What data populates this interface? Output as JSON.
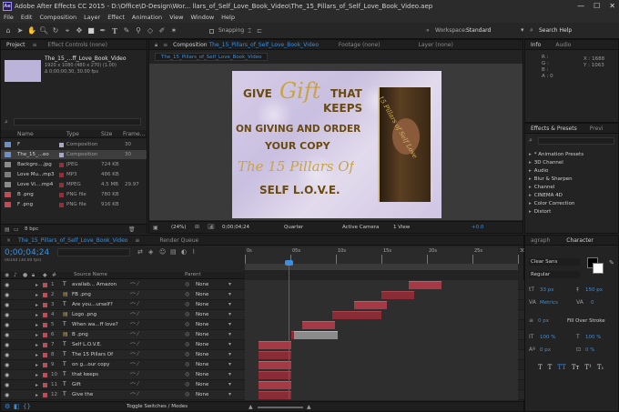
{
  "window": {
    "title": "Adobe After Effects CC 2015 - D:\\Office\\D-Design\\Wor... llars_of_Self_Love_Book_Video\\The_15_Pillars_of_Self_Love_Book_Video.aep",
    "minimize": "—",
    "maximize": "☐",
    "close": "✕"
  },
  "menu": [
    "File",
    "Edit",
    "Composition",
    "Layer",
    "Effect",
    "Animation",
    "View",
    "Window",
    "Help"
  ],
  "toolbar": {
    "snapping": "Snapping",
    "workspace_label": "Workspace:",
    "workspace_value": "Standard",
    "search_help": "Search Help"
  },
  "project": {
    "tab_project": "Project",
    "tab_effect_controls": "Effect Controls (none)",
    "comp_name": "The_15_...ff_Love_Book_Video",
    "comp_info1": "1920 x 1080  (480 x 270) (1.00)",
    "comp_info2": "Δ 0;00;00;30, 30.00 fps",
    "search_placeholder": "",
    "col_name": "Name",
    "col_type": "Type",
    "col_size": "Size",
    "col_frame": "Frame...",
    "items": [
      {
        "name": "F",
        "type": "Composition",
        "size": "",
        "frame": "30",
        "color": "#6f8fc7"
      },
      {
        "name": "The_15_...eo",
        "type": "Composition",
        "size": "",
        "frame": "30",
        "color": "#6f8fc7"
      },
      {
        "name": "Backgro....jpg",
        "type": "JPEG",
        "size": "724 KB",
        "frame": "",
        "color": "#8b8b8b"
      },
      {
        "name": "Love Mu...mp3",
        "type": "MP3",
        "size": "486 KB",
        "frame": "",
        "color": "#7d7d7d"
      },
      {
        "name": "Love Vi....mp4",
        "type": "MPEG",
        "size": "4.5 MB",
        "frame": "29.97",
        "color": "#8b8b8b"
      },
      {
        "name": "B .png",
        "type": "PNG file",
        "size": "780 KB",
        "frame": "",
        "color": "#c44a55"
      },
      {
        "name": "F .png",
        "type": "PNG file",
        "size": "916 KB",
        "frame": "",
        "color": "#c44a55"
      }
    ],
    "bpc": "8 bpc"
  },
  "composition": {
    "tab_label": "Composition",
    "tab_name": "The_15_Pillars_of_Self_Love_Book_Video",
    "tab_footage": "Footage (none)",
    "tab_layer": "Layer (none)",
    "subtab": "The_15_Pillars_of_Self_Love_Book_Video",
    "art": {
      "give": "GIVE",
      "gift": "Gift",
      "that": "THAT",
      "keeps": "KEEPS",
      "line2": "ON GIVING AND ORDER",
      "line3": "YOUR COPY",
      "script": "The 15 Pillars Of",
      "line5": "SELF L.O.V.E.",
      "book_title": "15 Pillars of Self Love"
    },
    "zoom": "(24%)",
    "timecode": "0;00;04;24",
    "resolution": "Quarter",
    "camera": "Active Camera",
    "views": "1 View",
    "exposure": "+0.0"
  },
  "info": {
    "tab_info": "Info",
    "tab_audio": "Audio",
    "r": "R :",
    "g": "G :",
    "b": "B :",
    "a": "A : 0",
    "x": "X : 1688",
    "y": "Y : 1063"
  },
  "effects": {
    "tab": "Effects & Presets",
    "tab2": "Previ",
    "search_placeholder": "",
    "items": [
      "* Animation Presets",
      "3D Channel",
      "Audio",
      "Blur & Sharpen",
      "Channel",
      "CINEMA 4D",
      "Color Correction",
      "Distort"
    ]
  },
  "timeline": {
    "tab_comp": "The_15_Pillars_of_Self_Love_Book_Video",
    "tab_render": "Render Queue",
    "timecode": "0;00;04;24",
    "timecode_sub": "00144 (30.00 fps)",
    "col_source": "Source Name",
    "col_parent": "Parent",
    "ruler": [
      "0s",
      "05s",
      "10s",
      "15s",
      "20s",
      "25s",
      "30s"
    ],
    "toggle": "Toggle Switches / Modes",
    "layers": [
      {
        "num": "1",
        "name": "availab... Amazon",
        "parent": "None",
        "color": "#c44a55",
        "start": 0.6,
        "end": 0.72
      },
      {
        "num": "2",
        "name": "FB .png",
        "parent": "None",
        "color": "#c44a55",
        "start": 0.5,
        "end": 0.62
      },
      {
        "num": "3",
        "name": "Are you...urself?",
        "parent": "None",
        "color": "#c44a55",
        "start": 0.4,
        "end": 0.52
      },
      {
        "num": "4",
        "name": "Logo .png",
        "parent": "None",
        "color": "#c44a55",
        "start": 0.32,
        "end": 0.5
      },
      {
        "num": "5",
        "name": "When wa...ff love?",
        "parent": "None",
        "color": "#c44a55",
        "start": 0.21,
        "end": 0.33
      },
      {
        "num": "6",
        "name": "B .png",
        "parent": "None",
        "color": "#c44a55",
        "start": 0.17,
        "end": 0.32
      },
      {
        "num": "7",
        "name": "Self L.O.V.E.",
        "parent": "None",
        "color": "#c44a55",
        "start": 0.05,
        "end": 0.17
      },
      {
        "num": "8",
        "name": "The 15 Pillars Of",
        "parent": "None",
        "color": "#c44a55",
        "start": 0.05,
        "end": 0.17
      },
      {
        "num": "9",
        "name": "on g...our copy",
        "parent": "None",
        "color": "#c44a55",
        "start": 0.05,
        "end": 0.17
      },
      {
        "num": "10",
        "name": "that keeps",
        "parent": "None",
        "color": "#c44a55",
        "start": 0.05,
        "end": 0.17
      },
      {
        "num": "11",
        "name": "Gift",
        "parent": "None",
        "color": "#c44a55",
        "start": 0.05,
        "end": 0.17
      },
      {
        "num": "12",
        "name": "Give the",
        "parent": "None",
        "color": "#c44a55",
        "start": 0.05,
        "end": 0.17
      }
    ]
  },
  "character": {
    "tab_paragraph": "agraph",
    "tab_character": "Character",
    "font": "Clear Sans",
    "style": "Regular",
    "size": "33 px",
    "leading": "150 px",
    "kerning": "Metrics",
    "tracking": "0",
    "stroke_width": "0 px",
    "stroke_mode": "Fill Over Stroke",
    "vscale": "100 %",
    "hscale": "100 %",
    "baseline": "0 px",
    "tsume": "0 %",
    "fill_color": "#000000",
    "stroke_color": "#ffffff"
  }
}
